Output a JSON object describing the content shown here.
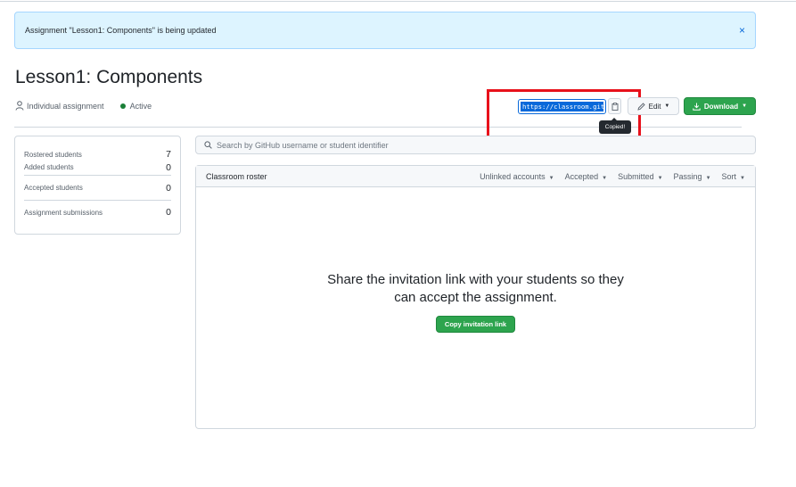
{
  "flash": {
    "message": "Assignment \"Lesson1: Components\" is being updated",
    "close_icon": "×"
  },
  "assignment": {
    "title": "Lesson1: Components",
    "type_label": "Individual assignment",
    "status_label": "Active",
    "status_color": "#1a7f37"
  },
  "toolbar": {
    "invite_url": "https://classroom.git",
    "copy_tooltip": "Copied!",
    "edit_label": "Edit",
    "download_label": "Download"
  },
  "stats": [
    {
      "label": "Rostered students",
      "value": "7"
    },
    {
      "label": "Added students",
      "value": "0"
    },
    {
      "label": "Accepted students",
      "value": "0"
    },
    {
      "label": "Assignment submissions",
      "value": "0"
    }
  ],
  "search": {
    "placeholder": "Search by GitHub username or student identifier"
  },
  "roster": {
    "title": "Classroom roster",
    "filters": [
      "Unlinked accounts",
      "Accepted",
      "Submitted",
      "Passing",
      "Sort"
    ],
    "empty_message": "Share the invitation link with your students so they can accept the assignment.",
    "copy_link_label": "Copy invitation link"
  },
  "colors": {
    "primary_green": "#2da44e",
    "accent_blue": "#0969da",
    "highlight_red": "#e8111b"
  }
}
